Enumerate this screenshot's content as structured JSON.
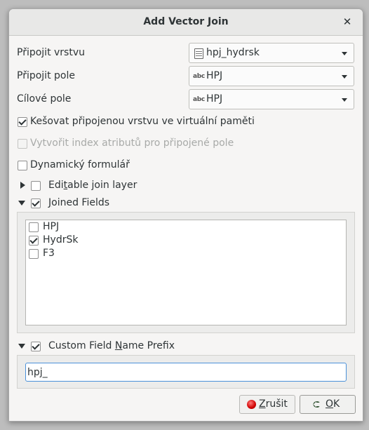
{
  "window": {
    "title": "Add Vector Join",
    "close_glyph": "✕"
  },
  "form": {
    "join_layer_label": "Připojit vrstvu",
    "join_layer_value": "hpj_hydrsk",
    "join_field_label": "Připojit pole",
    "join_field_value": "HPJ",
    "target_field_label": "Cílové pole",
    "target_field_value": "HPJ",
    "field_type_badge": "abc"
  },
  "options": {
    "cache_label": "Kešovat připojenou vrstvu ve virtuální paměti",
    "cache_checked": true,
    "index_label": "Vytvořit index atributů pro připojené pole",
    "index_checked": false,
    "index_enabled": false,
    "dynamic_label": "Dynamický formulář",
    "dynamic_checked": false
  },
  "editable_section": {
    "label_pre": "Edi",
    "label_mnemonic": "t",
    "label_post": "able join layer",
    "checked": false,
    "expanded": false
  },
  "joined_fields": {
    "label_pre": "",
    "label_mnemonic": "J",
    "label_post": "oined Fields",
    "checked": true,
    "expanded": true,
    "items": [
      {
        "name": "HPJ",
        "checked": false
      },
      {
        "name": "HydrSk",
        "checked": true
      },
      {
        "name": "F3",
        "checked": false
      }
    ]
  },
  "prefix_section": {
    "label_pre": "Custom Field ",
    "label_mnemonic": "N",
    "label_post": "ame Prefix",
    "checked": true,
    "expanded": true,
    "value": "hpj_"
  },
  "buttons": {
    "cancel_pre": "",
    "cancel_mnemonic": "Z",
    "cancel_post": "rušit",
    "ok_pre": "",
    "ok_mnemonic": "O",
    "ok_post": "K"
  }
}
